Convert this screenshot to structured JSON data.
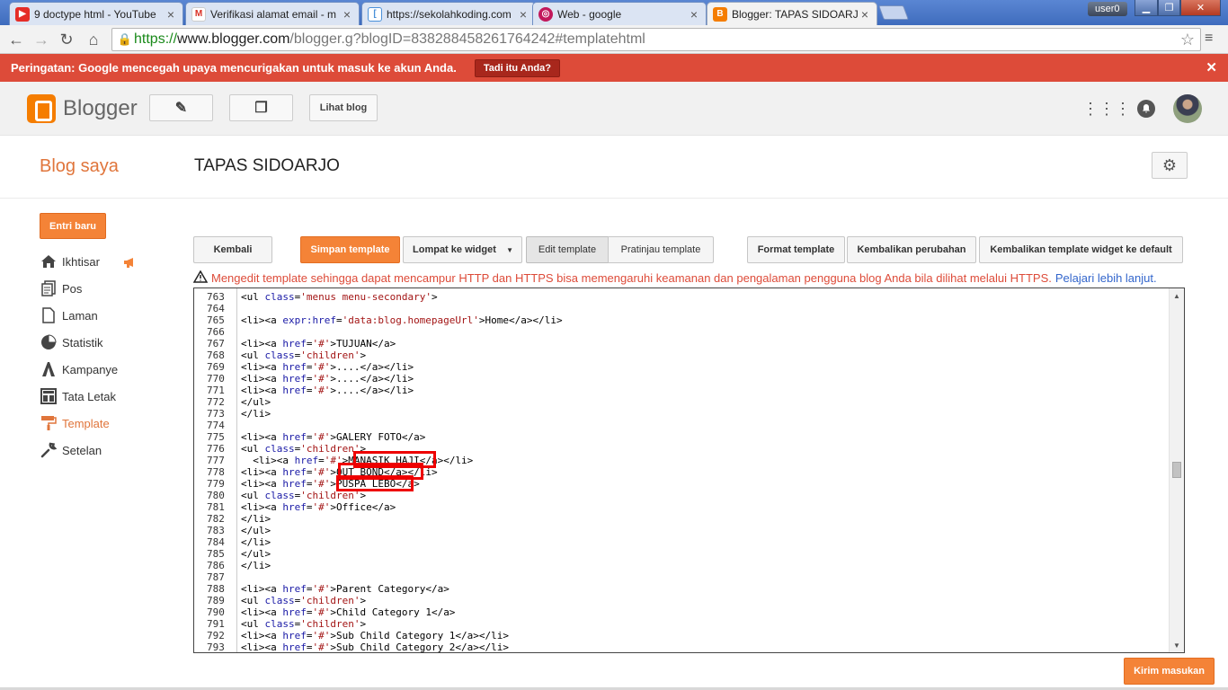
{
  "browser": {
    "tabs": [
      {
        "title": "9 doctype html - YouTube",
        "icon": "youtube-icon",
        "color": "#e52d27"
      },
      {
        "title": "Verifikasi alamat email - m",
        "icon": "gmail-icon",
        "color": "#d93025"
      },
      {
        "title": "https://sekolahkoding.com",
        "icon": "page-icon",
        "color": "#4a90d9"
      },
      {
        "title": "Web - google",
        "icon": "circle-icon",
        "color": "#c2185b"
      },
      {
        "title": "Blogger: TAPAS SIDOARJO",
        "icon": "blogger-icon",
        "color": "#f57d00",
        "active": true
      }
    ],
    "user": "user0",
    "url": {
      "scheme": "https://",
      "host": "www.blogger.com",
      "path": "/blogger.g?blogID=838288458261764242#templatehtml"
    }
  },
  "warning_banner": {
    "text": "Peringatan: Google mencegah upaya mencurigakan untuk masuk ke akun Anda.",
    "button": "Tadi itu Anda?",
    "close": "✕",
    "color": "#dd4b39"
  },
  "header": {
    "logo_text": "Blogger",
    "view_blog": "Lihat blog"
  },
  "blog": {
    "section": "Blog saya",
    "name": "TAPAS SIDOARJO"
  },
  "sidebar": {
    "new_post": "Entri baru",
    "items": [
      {
        "label": "Ikhtisar",
        "icon": "home-icon"
      },
      {
        "label": "Pos",
        "icon": "posts-icon"
      },
      {
        "label": "Laman",
        "icon": "page-icon"
      },
      {
        "label": "Statistik",
        "icon": "pie-chart-icon"
      },
      {
        "label": "Kampanye",
        "icon": "adwords-icon"
      },
      {
        "label": "Tata Letak",
        "icon": "layout-icon"
      },
      {
        "label": "Template",
        "icon": "paint-roller-icon",
        "active": true
      },
      {
        "label": "Setelan",
        "icon": "wrench-icon"
      }
    ]
  },
  "editor_toolbar": {
    "back": "Kembali",
    "save": "Simpan template",
    "jump": "Lompat ke widget",
    "edit": "Edit template",
    "preview": "Pratinjau template",
    "format": "Format template",
    "revert": "Kembalikan perubahan",
    "revert_widgets": "Kembalikan template widget ke default"
  },
  "warning_line": {
    "text": "Mengedit template sehingga dapat mencampur HTTP dan HTTPS bisa memengaruhi keamanan dan pengalaman pengguna blog Anda bila dilihat melalui HTTPS.",
    "link": "Pelajari lebih lanjut."
  },
  "code": {
    "lines": [
      {
        "n": "763",
        "text": "<ul class='menus menu-secondary'>"
      },
      {
        "n": "764",
        "text": ""
      },
      {
        "n": "765",
        "text": "<li><a expr:href='data:blog.homepageUrl'>Home</a></li>"
      },
      {
        "n": "766",
        "text": ""
      },
      {
        "n": "767",
        "text": "<li><a href='#'>TUJUAN</a>"
      },
      {
        "n": "768",
        "text": "<ul class='children'>"
      },
      {
        "n": "769",
        "text": "<li><a href='#'>....</a></li>"
      },
      {
        "n": "770",
        "text": "<li><a href='#'>....</a></li>"
      },
      {
        "n": "771",
        "text": "<li><a href='#'>....</a></li>"
      },
      {
        "n": "772",
        "text": "</ul>"
      },
      {
        "n": "773",
        "text": "</li>"
      },
      {
        "n": "774",
        "text": ""
      },
      {
        "n": "775",
        "text": "<li><a href='#'>GALERY FOTO</a>"
      },
      {
        "n": "776",
        "text": "<ul class='children'>"
      },
      {
        "n": "777",
        "text": "  <li><a href='#'>MANASIK HAJI</a></li>"
      },
      {
        "n": "778",
        "text": "<li><a href='#'>OUT BOND</a></li>"
      },
      {
        "n": "779",
        "text": "<li><a href='#'>PUSPA LEBO</a>"
      },
      {
        "n": "780",
        "text": "<ul class='children'>"
      },
      {
        "n": "781",
        "text": "<li><a href='#'>Office</a>"
      },
      {
        "n": "782",
        "text": "</li>"
      },
      {
        "n": "783",
        "text": "</ul>"
      },
      {
        "n": "784",
        "text": "</li>"
      },
      {
        "n": "785",
        "text": "</ul>"
      },
      {
        "n": "786",
        "text": "</li>"
      },
      {
        "n": "787",
        "text": ""
      },
      {
        "n": "788",
        "text": "<li><a href='#'>Parent Category</a>"
      },
      {
        "n": "789",
        "text": "<ul class='children'>"
      },
      {
        "n": "790",
        "text": "<li><a href='#'>Child Category 1</a>"
      },
      {
        "n": "791",
        "text": "<ul class='children'>"
      },
      {
        "n": "792",
        "text": "<li><a href='#'>Sub Child Category 1</a></li>"
      },
      {
        "n": "793",
        "text": "<li><a href='#'>Sub Child Category 2</a></li>"
      }
    ],
    "highlight_color": "#e00000"
  },
  "feedback": "Kirim masukan"
}
